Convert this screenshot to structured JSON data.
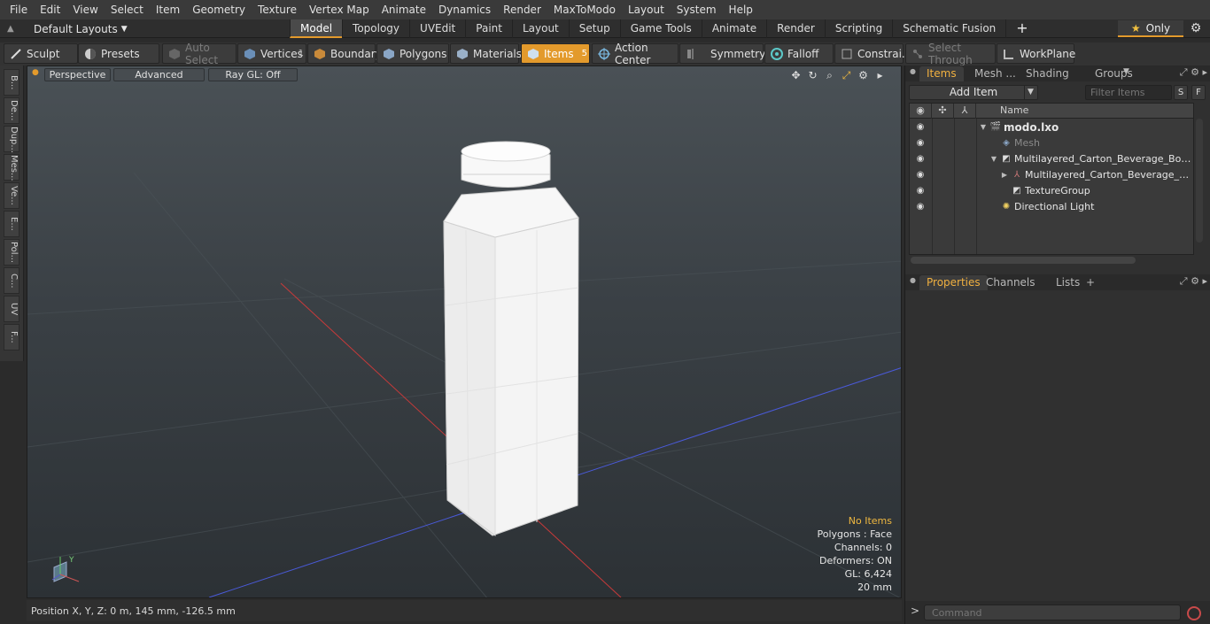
{
  "menu": [
    "File",
    "Edit",
    "View",
    "Select",
    "Item",
    "Geometry",
    "Texture",
    "Vertex Map",
    "Animate",
    "Dynamics",
    "Render",
    "MaxToModo",
    "Layout",
    "System",
    "Help"
  ],
  "layouts": {
    "current": "Default Layouts",
    "tabs": [
      "Model",
      "Topology",
      "UVEdit",
      "Paint",
      "Layout",
      "Setup",
      "Game Tools",
      "Animate",
      "Render",
      "Scripting",
      "Schematic Fusion"
    ],
    "active_tab": "Model",
    "add_label": "+",
    "only_label": "Only"
  },
  "toolbar": {
    "sculpt": "Sculpt",
    "presets": "Presets",
    "auto_select": "Auto Select",
    "vertices": "Vertices",
    "vertices_count": "1",
    "boundary": "Boundary",
    "polygons": "Polygons",
    "materials": "Materials",
    "items": "Items",
    "items_count": "5",
    "action_center": "Action Center",
    "symmetry": "Symmetry",
    "falloff": "Falloff",
    "constraints": "Constrai...",
    "select_through": "Select Through",
    "workplane": "WorkPlane"
  },
  "left_tabs": [
    "B...",
    "De...",
    "Dup...",
    "Mes...",
    "Ve...",
    "E...",
    "Pol...",
    "C...",
    "UV",
    "F..."
  ],
  "viewport": {
    "view_mode": "Perspective",
    "shading": "Advanced",
    "ray_gl": "Ray GL: Off",
    "stats": {
      "selection": "No Items",
      "polygons": "Polygons : Face",
      "channels": "Channels: 0",
      "deformers": "Deformers: ON",
      "gl": "GL: 6,424",
      "grid": "20 mm"
    },
    "axis_y": "Y"
  },
  "status": {
    "position": "Position X, Y, Z:   0 m, 145 mm, -126.5 mm"
  },
  "items_panel": {
    "tabs": [
      "Items",
      "Mesh ...",
      "Shading",
      "Groups"
    ],
    "active_tab": "Items",
    "add_item": "Add Item",
    "filter_placeholder": "Filter Items",
    "s_btn": "S",
    "f_btn": "F",
    "name_header": "Name",
    "tree": [
      {
        "label": "modo.lxo",
        "indent": 0,
        "arrow": "▼",
        "icon": "scene-icon",
        "bold": true
      },
      {
        "label": "Mesh",
        "indent": 1,
        "arrow": "",
        "icon": "mesh-icon",
        "dim": true
      },
      {
        "label": "Multilayered_Carton_Beverage_Bottl ...",
        "indent": 1,
        "arrow": "▼",
        "icon": "locator-icon"
      },
      {
        "label": "Multilayered_Carton_Beverage_Bo ...",
        "indent": 2,
        "arrow": "▶",
        "icon": "group-icon"
      },
      {
        "label": "TextureGroup",
        "indent": 2,
        "arrow": "",
        "icon": "texture-group-icon"
      },
      {
        "label": "Directional Light",
        "indent": 1,
        "arrow": "",
        "icon": "light-icon"
      }
    ]
  },
  "properties_panel": {
    "tabs": [
      "Properties",
      "Channels",
      "Lists"
    ],
    "active_tab": "Properties",
    "add_label": "+"
  },
  "command": {
    "prompt": ">",
    "placeholder": "Command"
  },
  "colors": {
    "accent": "#e39a2c",
    "stats_highlight": "#f0b840",
    "x_axis": "#c83a3a",
    "z_axis": "#3a4ac8"
  }
}
